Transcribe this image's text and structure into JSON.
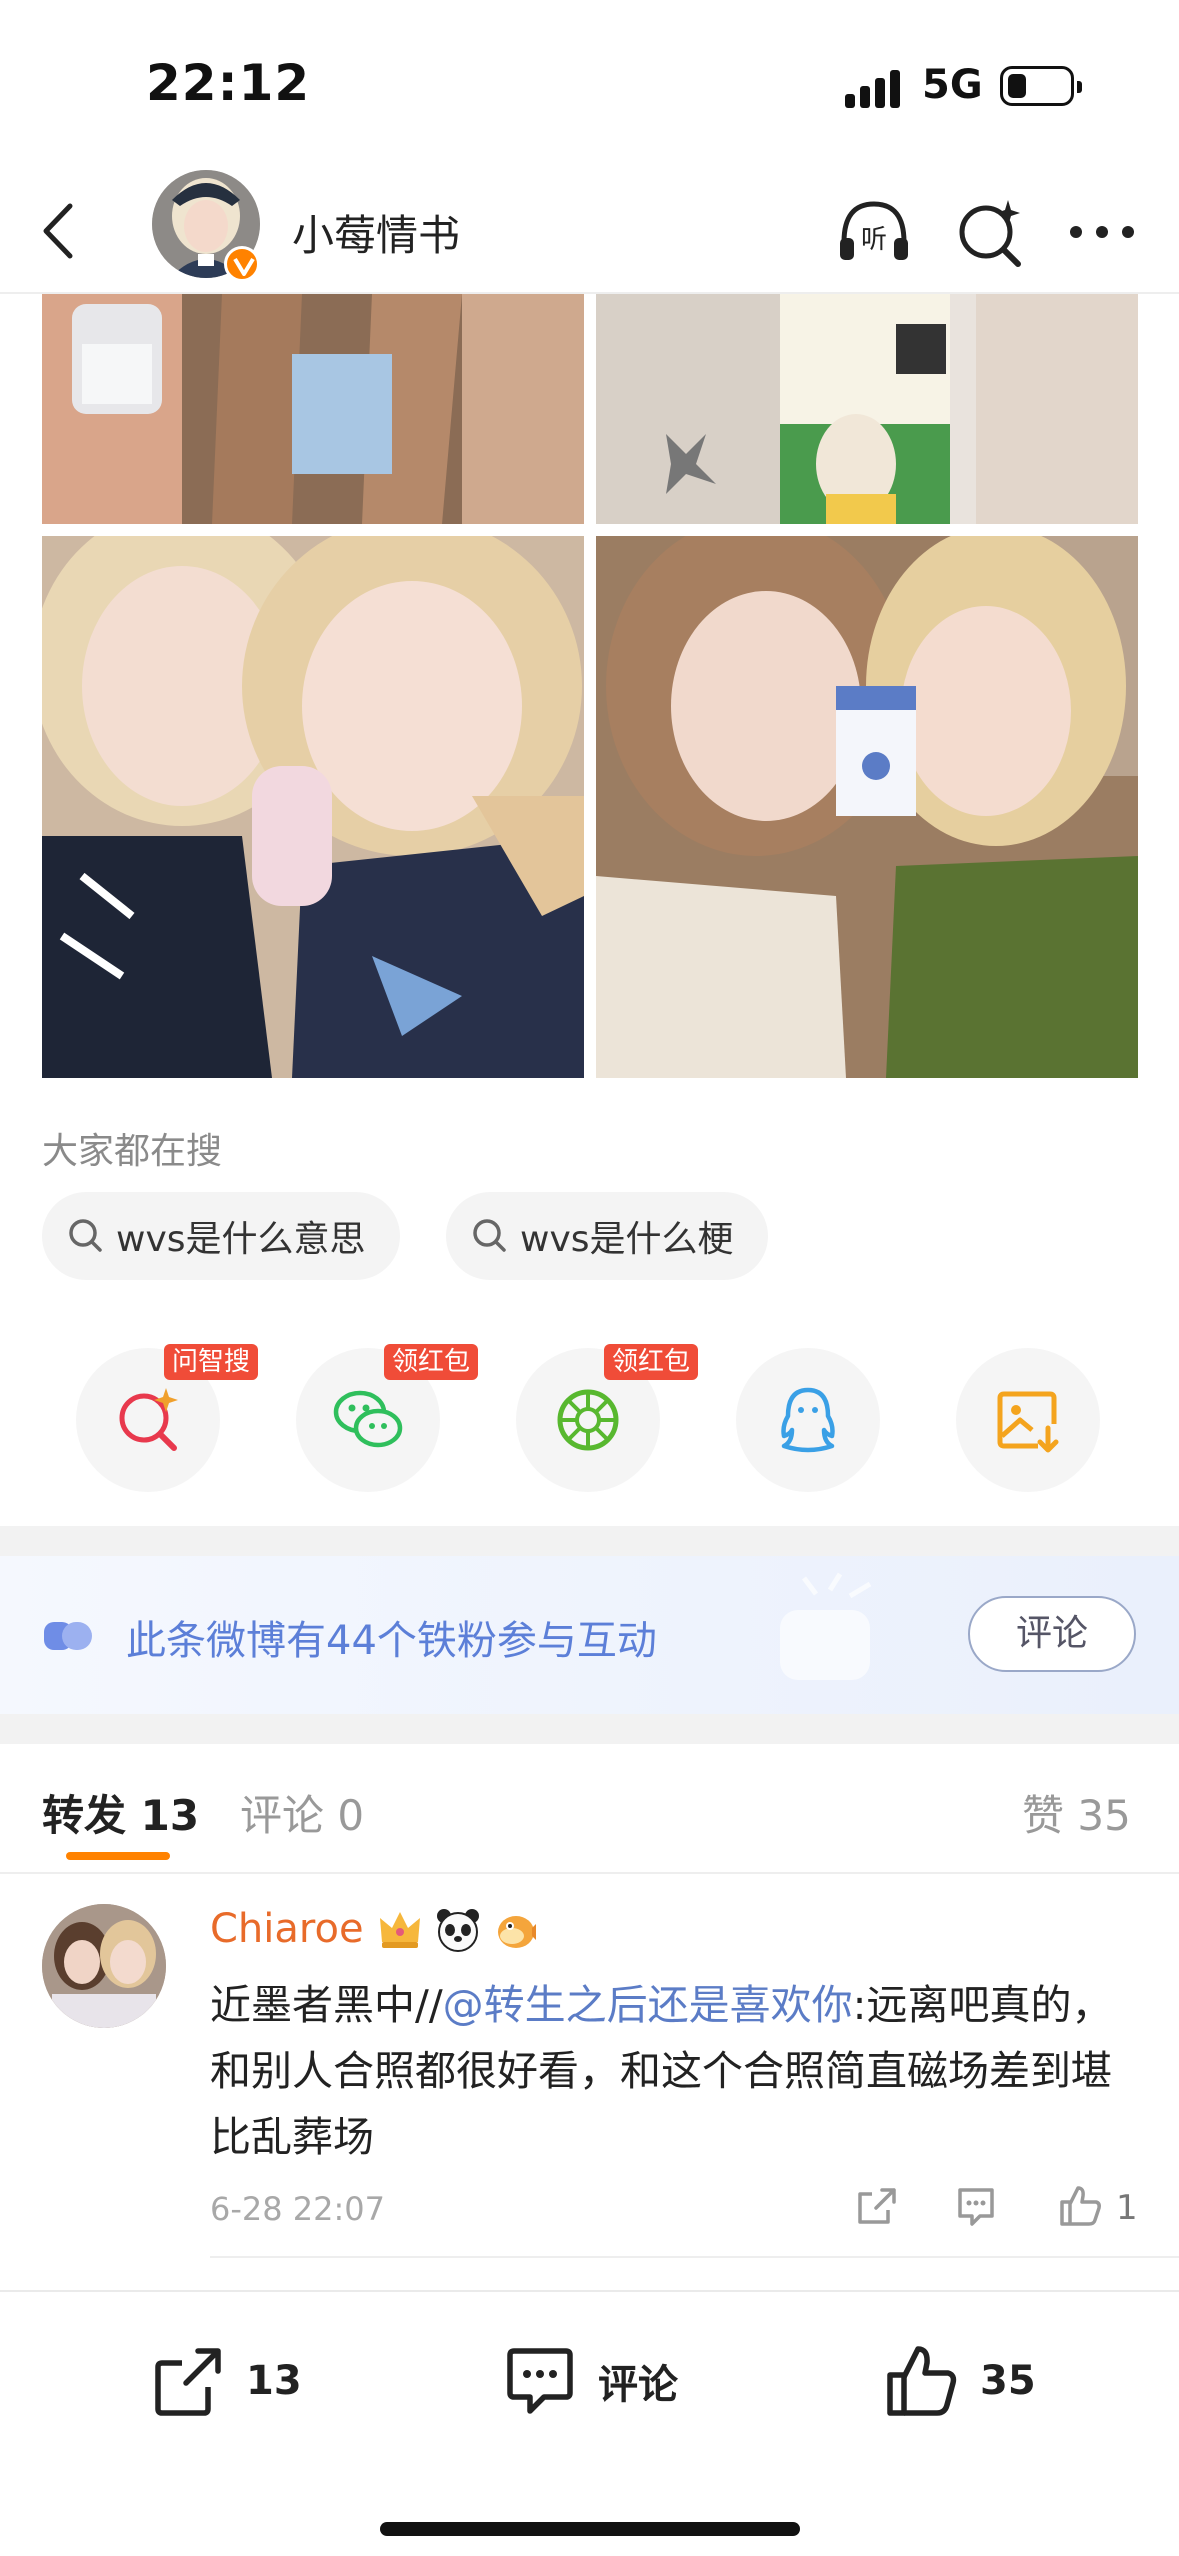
{
  "status_bar": {
    "time": "22:12",
    "network": "5G"
  },
  "header": {
    "title": "小莓情书"
  },
  "search_suggestions": {
    "title": "大家都在搜",
    "chips": [
      "wvs是什么意思",
      "wvs是什么梗"
    ]
  },
  "share_row": {
    "items": [
      {
        "icon": "ai-search-icon",
        "badge": "问智搜"
      },
      {
        "icon": "wechat-icon",
        "badge": "领红包"
      },
      {
        "icon": "moments-icon",
        "badge": "领红包"
      },
      {
        "icon": "qq-icon",
        "badge": ""
      },
      {
        "icon": "save-image-icon",
        "badge": ""
      }
    ]
  },
  "fans_banner": {
    "text": "此条微博有44个铁粉参与互动",
    "button": "评论"
  },
  "tabs": {
    "repost": "转发 13",
    "comment": "评论 0",
    "like": "赞 35"
  },
  "comment": {
    "username": "Chiaroe",
    "text_prefix": "近墨者黑中//",
    "mention": "@转生之后还是喜欢你",
    "text_rest": ":远离吧真的，和别人合照都很好看，和这个合照简直磁场差到堪比乱葬场",
    "time": "6-28 22:07",
    "like_count": "1"
  },
  "bottom_bar": {
    "repost_count": "13",
    "comment_label": "评论",
    "like_count": "35"
  },
  "colors": {
    "accent": "#ff8200",
    "mention": "#5b7cc6",
    "banner_text": "#5c7fd8",
    "badge_red": "#f04c38"
  }
}
